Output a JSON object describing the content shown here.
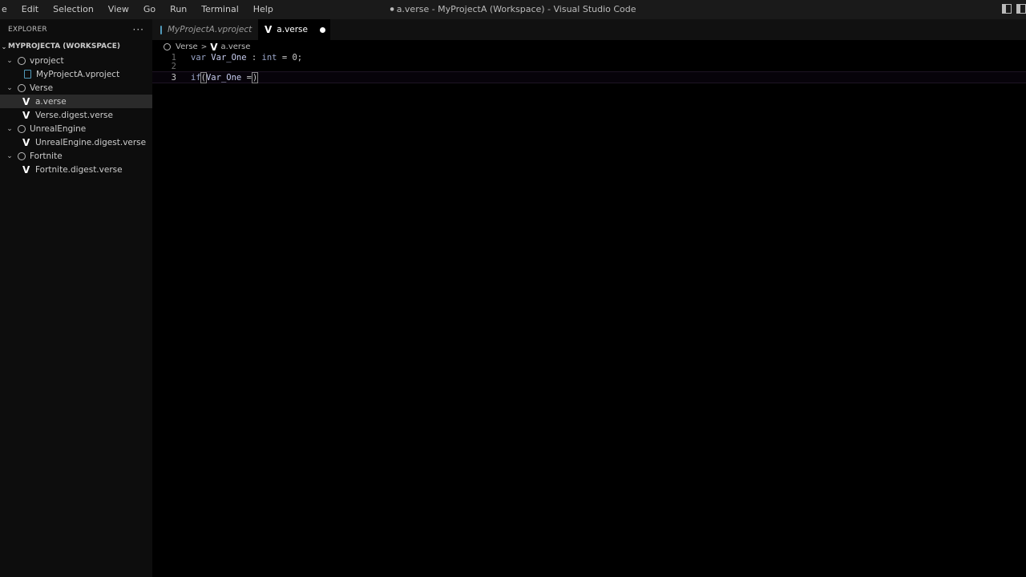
{
  "menu": [
    "e",
    "Edit",
    "Selection",
    "View",
    "Go",
    "Run",
    "Terminal",
    "Help"
  ],
  "window_title": "a.verse - MyProjectA (Workspace) - Visual Studio Code",
  "sidebar": {
    "header": "EXPLORER",
    "more": "···",
    "workspace": "MYPROJECTA (WORKSPACE)",
    "folders": [
      {
        "name": "vproject",
        "files": [
          "MyProjectA.vproject"
        ]
      },
      {
        "name": "Verse",
        "files": [
          "a.verse",
          "Verse.digest.verse"
        ]
      },
      {
        "name": "UnrealEngine",
        "files": [
          "UnrealEngine.digest.verse"
        ]
      },
      {
        "name": "Fortnite",
        "files": [
          "Fortnite.digest.verse"
        ]
      }
    ]
  },
  "tabs": {
    "inactive": "MyProjectA.vproject",
    "active": "a.verse"
  },
  "breadcrumb": {
    "folder": "Verse",
    "file": "a.verse"
  },
  "editor": {
    "line_numbers": [
      "1",
      "2",
      "3"
    ],
    "line1": {
      "kw_var": "var",
      "ident": "Var_One",
      "colon": " : ",
      "type": "int",
      "rest": " = 0;"
    },
    "line3": {
      "kw_if": "if",
      "open": "(",
      "ident": "Var_One",
      "op": " =",
      "close": ")"
    }
  },
  "icons": {
    "verse_glyph": "V",
    "chevron": "⌄"
  }
}
